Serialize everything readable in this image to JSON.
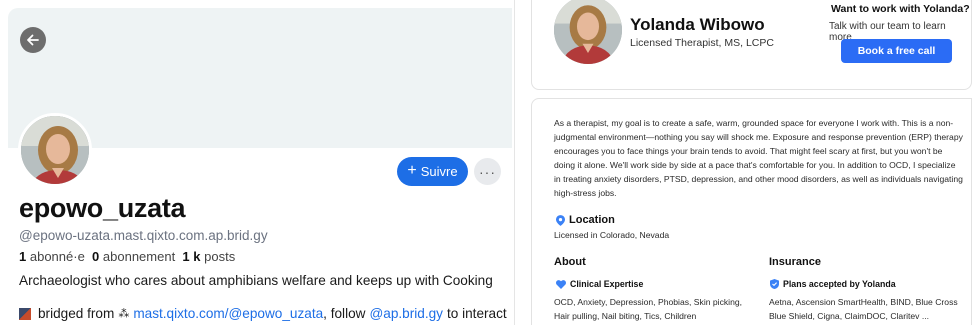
{
  "profile": {
    "display_name": "epowo_uzata",
    "handle": "@epowo-uzata.mast.qixto.com.ap.brid.gy",
    "followers_count": "1",
    "followers_label": "abonné·e",
    "following_count": "0",
    "following_label": "abonnement",
    "posts_count": "1 k",
    "posts_label": "posts",
    "bio": "Archaeologist who cares about amphibians welfare and keeps up with Cooking",
    "bridged_prefix": "bridged from",
    "bridged_link": "mast.qixto.com/@epowo_uzata",
    "bridged_middle": ", follow",
    "follow_link": "@ap.brid.gy",
    "bridged_suffix": "to interact",
    "follow_button": "Suivre",
    "more_button": "···"
  },
  "therapist": {
    "name": "Yolanda Wibowo",
    "credentials": "Licensed Therapist, MS, LCPC",
    "cta_title": "Want to work with Yolanda?",
    "cta_subtitle": "Talk with our team to learn more",
    "book_button": "Book a free call",
    "about_text": "As a therapist, my goal is to create a safe, warm, grounded space for everyone I work with. This is a non-judgmental environment—nothing you say will shock me. Exposure and response prevention (ERP) therapy encourages you to face things your brain tends to avoid. That might feel scary at first, but you won't be doing it alone. We'll work side by side at a pace that's comfortable for you. In addition to OCD, I specialize in treating anxiety disorders, PTSD, depression, and other mood disorders, as well as individuals navigating high-stress jobs.",
    "location_title": "Location",
    "location_text": "Licensed in Colorado, Nevada",
    "about_heading": "About",
    "insurance_heading": "Insurance",
    "clinical_heading": "Clinical Expertise",
    "clinical_text": "OCD, Anxiety, Depression, Phobias, Skin picking, Hair pulling, Nail biting, Tics, Children",
    "plans_heading": "Plans accepted by Yolanda",
    "plans_text": "Aetna, Ascension SmartHealth, BIND, Blue Cross Blue Shield, Cigna, ClaimDOC, Claritev ..."
  },
  "colors": {
    "accent_blue": "#1d6ee6",
    "book_blue": "#2b6cf5",
    "banner": "#eef3f4",
    "icon_blue": "#3b82f6"
  },
  "icons": {
    "back": "arrow-left-icon",
    "more": "ellipsis-icon",
    "pin": "map-pin-icon",
    "heart": "heart-icon",
    "shield": "shield-check-icon"
  }
}
